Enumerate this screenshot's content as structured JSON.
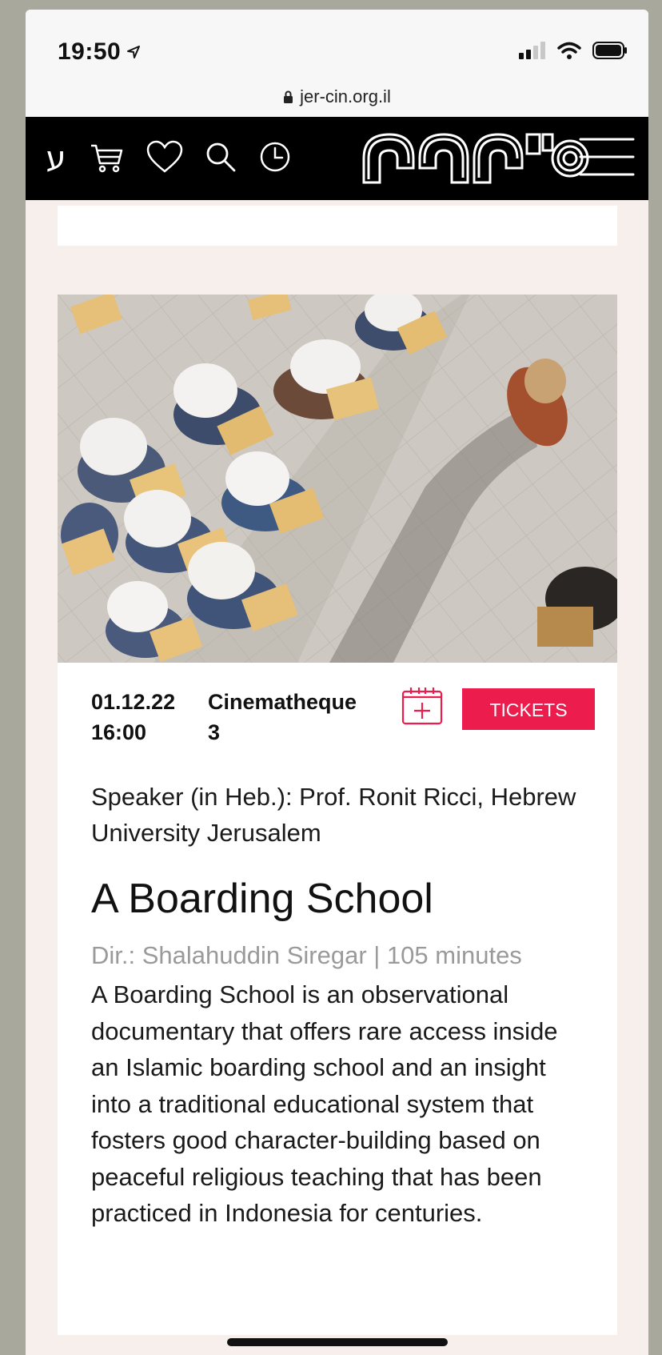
{
  "status_bar": {
    "time": "19:50",
    "url": "jer-cin.org.il"
  },
  "nav": {
    "lang_label": "ע",
    "icons": [
      "cart-icon",
      "heart-icon",
      "search-icon",
      "clock-icon"
    ],
    "logo_text": "סינמטק",
    "menu_icon": "hamburger-menu-icon",
    "background": "#000000"
  },
  "event": {
    "date": "01.12.22",
    "time": "16:00",
    "venue_line1": "Cinematheque",
    "venue_line2": "3",
    "tickets_label": "TICKETS",
    "tickets_color": "#ec1c4d",
    "speaker": "Speaker (in Heb.): Prof. Ronit Ricci, Hebrew University Jerusalem",
    "title": "A Boarding School",
    "director_line": "Dir.: Shalahuddin Siregar | 105 minutes",
    "description": "A Boarding School is an observational documentary that offers rare access inside an Islamic boarding school and an insight into a traditional educational system that fosters good character-building based on peaceful religious teaching that has been practiced in Indonesia for centuries."
  }
}
